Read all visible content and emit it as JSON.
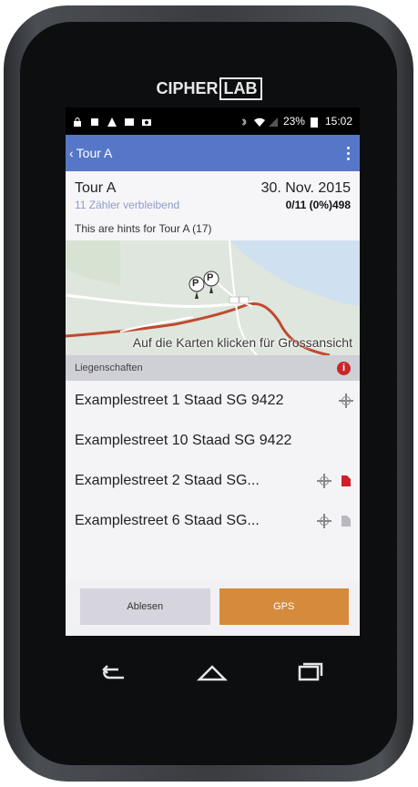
{
  "device": {
    "brand_a": "CIPHER",
    "brand_b": "LAB"
  },
  "statusbar": {
    "battery": "23%",
    "time": "15:02"
  },
  "appbar": {
    "back_label": "Tour A"
  },
  "header": {
    "title": "Tour A",
    "date": "30. Nov. 2015",
    "remaining": "11 Zähler verbleibend",
    "progress": "0/11 (0%)498",
    "hints": "This are hints for Tour A (17)"
  },
  "map": {
    "caption": "Auf die Karten klicken für Grossansicht",
    "marker1": "P",
    "marker2": "P"
  },
  "section": {
    "title": "Liegenschaften",
    "alert_icon": "i"
  },
  "list": [
    {
      "label": "Examplestreet 1 Staad SG 9422"
    },
    {
      "label": "Examplestreet 10 Staad SG 9422"
    },
    {
      "label": "Examplestreet 2 Staad SG..."
    },
    {
      "label": "Examplestreet 6 Staad SG..."
    }
  ],
  "buttons": {
    "ablesen": "Ablesen",
    "gps": "GPS"
  },
  "colors": {
    "appbar": "#5677c8",
    "gps": "#d68a3b",
    "alert": "#c8262c"
  }
}
